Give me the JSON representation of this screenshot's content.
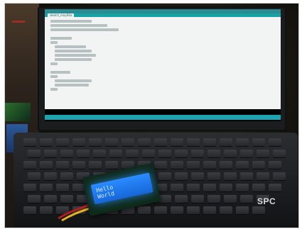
{
  "image": {
    "description": "",
    "lcd_lines": [
      "Hello",
      "World"
    ],
    "keyboard_brand": "SPC",
    "colors": {
      "lcd_backlight": "#2a8cff",
      "screen_background": "#dfe9ea",
      "ide_accent": "#17a1a5",
      "keyboard": "#2b2d31"
    },
    "icons": [
      "laptop-icon",
      "keyboard-icon",
      "lcd-display-icon",
      "wire-icon"
    ]
  },
  "ide": {
    "tab_label": "sketch_may04a",
    "code_lines": [
      "#include <Wire.h>",
      "#include <LiquidCrystal_I2C.h>",
      "LiquidCrystal_I2C lcd(0x27, 16, 2);",
      "",
      "void setup()",
      "{",
      "  lcd.init();",
      "  lcd.backlight();",
      "  lcd.setCursor(0,0);",
      "  lcd.print(\"Hello\");",
      "}",
      "",
      "void loop()",
      "{",
      "}"
    ]
  }
}
